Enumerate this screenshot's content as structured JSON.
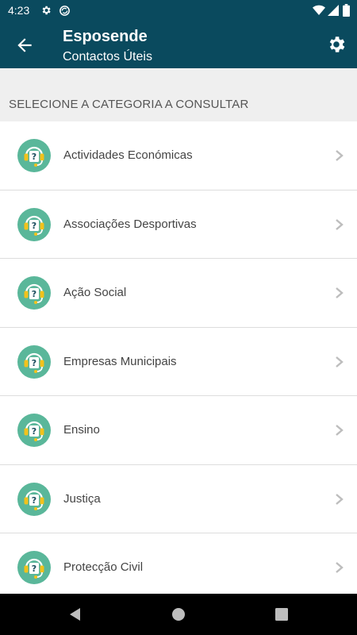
{
  "status_bar": {
    "time": "4:23",
    "icons": [
      "gear-icon",
      "sync-icon",
      "wifi-icon",
      "signal-icon",
      "battery-icon"
    ]
  },
  "app_bar": {
    "title": "Esposende",
    "subtitle": "Contactos Úteis",
    "back_icon": "arrow-back-icon",
    "settings_icon": "gear-icon",
    "color": "#0a4a5e"
  },
  "section_header": "SELECIONE A CATEGORIA A CONSULTAR",
  "categories": [
    {
      "label": "Actividades Económicas"
    },
    {
      "label": "Associações Desportivas"
    },
    {
      "label": "Ação Social"
    },
    {
      "label": "Empresas Municipais"
    },
    {
      "label": "Ensino"
    },
    {
      "label": "Justiça"
    },
    {
      "label": "Protecção Civil"
    }
  ],
  "category_icon": "help-headset-icon",
  "row_chevron_icon": "chevron-right-icon",
  "accent_color": "#5ab79a",
  "nav_bar": {
    "icons": [
      "back-triangle-icon",
      "home-circle-icon",
      "recents-square-icon"
    ]
  }
}
